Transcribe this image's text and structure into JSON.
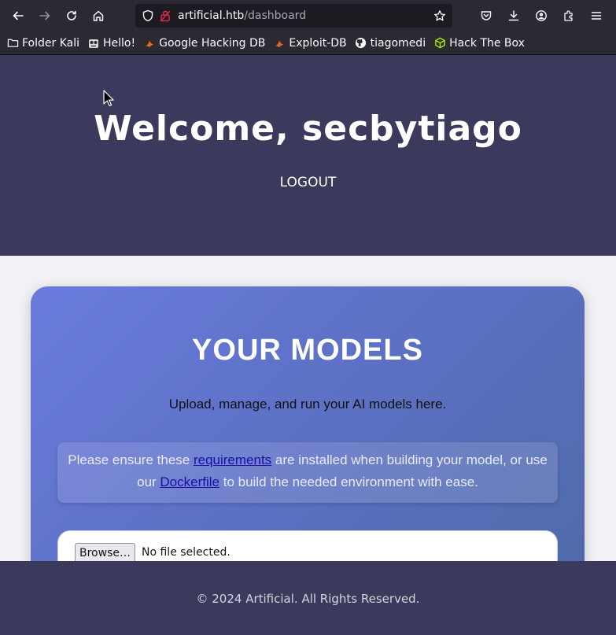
{
  "browser": {
    "url_host": "artificial.htb",
    "url_path": "/dashboard",
    "bookmarks": [
      {
        "label": "Folder Kali",
        "icon": "folder-icon"
      },
      {
        "label": "Hello!",
        "icon": "owl-icon"
      },
      {
        "label": "Google Hacking DB",
        "icon": "exploit-icon"
      },
      {
        "label": "Exploit-DB",
        "icon": "exploit-icon"
      },
      {
        "label": "tiagomedi",
        "icon": "github-icon"
      },
      {
        "label": "Hack The Box",
        "icon": "htb-cube-icon"
      }
    ]
  },
  "header": {
    "welcome": "Welcome, secbytiago",
    "logout_label": "LOGOUT"
  },
  "models": {
    "title": "YOUR MODELS",
    "subtitle": "Upload, manage, and run your AI models here.",
    "notice_before": "Please ensure these ",
    "requirements_link": "requirements",
    "notice_middle": " are installed when building your model, or use our ",
    "dockerfile_link": "Dockerfile",
    "notice_after": " to build the needed environment with ease.",
    "browse_label": "Browse…",
    "file_status": "No file selected."
  },
  "footer": {
    "copyright": "© 2024 Artificial. All Rights Reserved."
  },
  "colors": {
    "hero_bg": "#3b3a5c",
    "card_gradient_start": "#6a7bdc",
    "card_gradient_end": "#4e6aa7",
    "link": "#1a0dab"
  }
}
